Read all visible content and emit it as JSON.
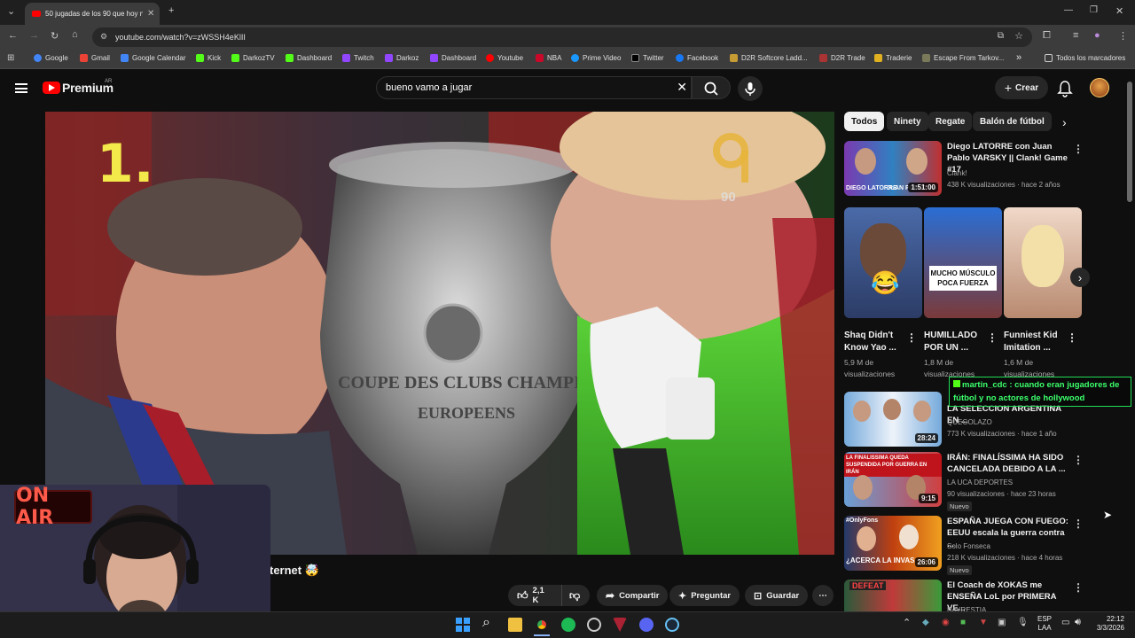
{
  "browser": {
    "tab_title": "50 jugadas de los 90 que hoy n",
    "url": "youtube.com/watch?v=zWSSH4eKlII",
    "bookmarks": [
      "Google",
      "Gmail",
      "Google Calendar",
      "Kick",
      "DarkozTV",
      "Dashboard",
      "Twitch",
      "Darkoz",
      "Dashboard",
      "Youtube",
      "NBA",
      "Prime Video",
      "Twitter",
      "Facebook",
      "D2R Softcore Ladd...",
      "D2R Trade",
      "Traderie",
      "Escape From Tarkov..."
    ],
    "all_bookmarks": "Todos los marcadores",
    "more_bookmarks": "»"
  },
  "youtube": {
    "logo_text": "Premium",
    "logo_region": "AR",
    "search_value": "bueno vamo a jugar",
    "create_label": "Crear",
    "video_overlay_number": "1.",
    "video_channel_mark": "90",
    "trophy_text_1": "COUPE DES CLUBS CHAMPIONS",
    "trophy_text_2": "EUROPEENS",
    "video_title_fragment": "ternet 🤯",
    "actions": {
      "likes": "2,1 K",
      "share": "Compartir",
      "ask": "Preguntar",
      "save": "Guardar"
    },
    "chips": [
      "Todos",
      "Ninety",
      "Regate",
      "Balón de fútbol"
    ],
    "recs": [
      {
        "title": "Diego LATORRE con Juan Pablo VARSKY || Clank! Game #17",
        "channel": "Clank!",
        "meta": "438 K visualizaciones · hace 2 años",
        "duration": "1:51:00"
      },
      {
        "title": "LA SELECCION ARGENTINA EN ...",
        "channel": "QUEGOLAZO",
        "meta": "773 K visualizaciones · hace 1 año",
        "duration": "28:24"
      },
      {
        "title": "IRÁN: FINALÍSSIMA HA SIDO CANCELADA DEBIDO A LA ...",
        "channel": "LA UCA DEPORTES",
        "meta": "90 visualizaciones · hace 23 horas",
        "badge": "Nuevo",
        "duration": "9:15"
      },
      {
        "title": "ESPAÑA JUEGA CON FUEGO: EEUU escala la guerra contra ...",
        "channel": "Solo Fonseca",
        "meta": "218 K visualizaciones · hace 4 horas",
        "badge": "Nuevo",
        "duration": "26:06"
      },
      {
        "title": "El Coach de XOKAS me ENSEÑA LoL por PRIMERA VE...",
        "channel": "BAYRESTIA",
        "meta": ""
      }
    ],
    "shorts": [
      {
        "title": "Shaq Didn't Know Yao ...",
        "views": "5,9 M de visualizaciones"
      },
      {
        "title": "HUMILLADO POR UN ...",
        "views": "1,8 M de visualizaciones",
        "overlay": "MUCHO MÚSCULO POCA FUERZA"
      },
      {
        "title": "Funniest Kid Imitation ...",
        "views": "1,6 M de visualizaciones"
      }
    ],
    "thumb_texts": {
      "latorre_1": "DIEGO LATORRE",
      "latorre_2": "JUAN PABLO VA",
      "thumb3": "LA FINALISSIMA QUEDA SUSPENDIDA POR GUERRA EN IRÁN",
      "thumb4a": "#OnlyFons",
      "thumb4b": "¿ACERCA LA INVAS",
      "thumb5": "DEFEAT"
    }
  },
  "chat": {
    "message": "martin_cdc : cuando eran jugadores de fútbol y no actores de hollywood"
  },
  "overlay": {
    "on_air": "ON AIR"
  },
  "taskbar": {
    "lang_1": "ESP",
    "lang_2": "LAA",
    "time": "22:12",
    "date": "3/3/2026"
  }
}
